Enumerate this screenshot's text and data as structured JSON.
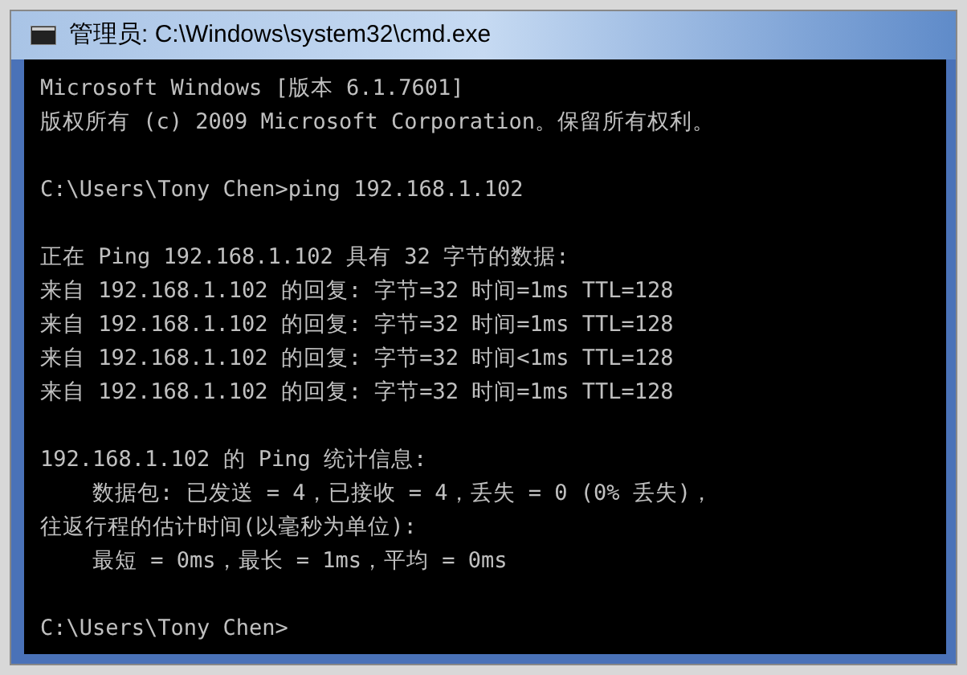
{
  "window": {
    "title": "管理员: C:\\Windows\\system32\\cmd.exe"
  },
  "console": {
    "blocks": [
      [
        "Microsoft Windows [版本 6.1.7601]",
        "版权所有 (c) 2009 Microsoft Corporation。保留所有权利。"
      ],
      [
        "C:\\Users\\Tony Chen>ping 192.168.1.102"
      ],
      [
        "正在 Ping 192.168.1.102 具有 32 字节的数据:",
        "来自 192.168.1.102 的回复: 字节=32 时间=1ms TTL=128",
        "来自 192.168.1.102 的回复: 字节=32 时间=1ms TTL=128",
        "来自 192.168.1.102 的回复: 字节=32 时间<1ms TTL=128",
        "来自 192.168.1.102 的回复: 字节=32 时间=1ms TTL=128"
      ],
      [
        "192.168.1.102 的 Ping 统计信息:",
        "    数据包: 已发送 = 4，已接收 = 4，丢失 = 0 (0% 丢失)，",
        "往返行程的估计时间(以毫秒为单位):",
        "    最短 = 0ms，最长 = 1ms，平均 = 0ms"
      ],
      [
        "C:\\Users\\Tony Chen>"
      ]
    ]
  }
}
